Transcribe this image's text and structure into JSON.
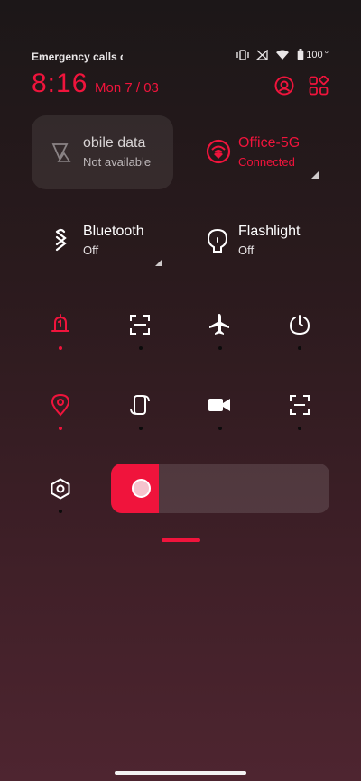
{
  "status_bar": {
    "emergency": "Emergency calls o",
    "time": "8:16",
    "date": "Mon 7 / 03",
    "battery": "100"
  },
  "header": {
    "profile_icon": "profile-icon",
    "edit_icon": "grid-edit-icon"
  },
  "tiles": {
    "mobile_data": {
      "title": "obile data",
      "subtitle": "Not available",
      "icon": "mobile-data-icon"
    },
    "wifi": {
      "title": "Office-5G",
      "subtitle": "Connected",
      "icon": "wifi-icon"
    },
    "bluetooth": {
      "title": "Bluetooth",
      "subtitle": "Off",
      "icon": "bluetooth-icon"
    },
    "flashlight": {
      "title": "Flashlight",
      "subtitle": "Off",
      "icon": "flashlight-icon"
    }
  },
  "quick_toggles": [
    {
      "icon": "bell-icon",
      "active": true
    },
    {
      "icon": "scan-icon",
      "active": false
    },
    {
      "icon": "airplane-icon",
      "active": false
    },
    {
      "icon": "power-icon",
      "active": false
    },
    {
      "icon": "location-icon",
      "active": true
    },
    {
      "icon": "auto-rotate-icon",
      "active": false
    },
    {
      "icon": "video-camera-icon",
      "active": false
    },
    {
      "icon": "screenshot-icon",
      "active": false
    },
    {
      "icon": "settings-icon",
      "active": false
    }
  ],
  "brightness": {
    "level": 0.22
  },
  "colors": {
    "accent": "#f0143c",
    "text": "#ffffff",
    "muted": "#bdb7b9"
  }
}
